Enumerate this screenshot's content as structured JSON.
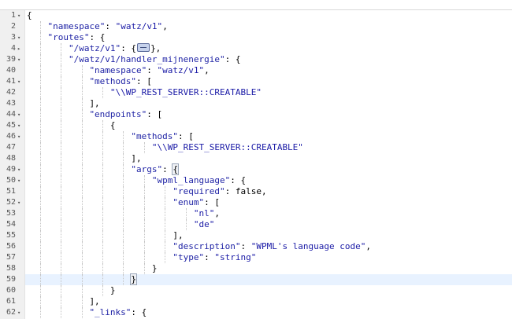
{
  "lines": [
    {
      "num": "1",
      "fold": "open",
      "indent": 0,
      "tokens": [
        [
          "plain",
          "{"
        ]
      ]
    },
    {
      "num": "2",
      "indent": 1,
      "tokens": [
        [
          "key",
          "\"namespace\""
        ],
        [
          "plain",
          ": "
        ],
        [
          "str",
          "\"watz/v1\""
        ],
        [
          "plain",
          ","
        ]
      ]
    },
    {
      "num": "3",
      "fold": "open",
      "indent": 1,
      "tokens": [
        [
          "key",
          "\"routes\""
        ],
        [
          "plain",
          ": {"
        ]
      ]
    },
    {
      "num": "4",
      "fold": "closed",
      "indent": 2,
      "tokens": [
        [
          "key",
          "\"/watz/v1\""
        ],
        [
          "plain",
          ": {"
        ],
        [
          "widget",
          ""
        ],
        [
          "plain",
          "},"
        ]
      ]
    },
    {
      "num": "39",
      "fold": "open",
      "indent": 2,
      "tokens": [
        [
          "key",
          "\"/watz/v1/handler_mijnenergie\""
        ],
        [
          "plain",
          ": {"
        ]
      ]
    },
    {
      "num": "40",
      "indent": 3,
      "tokens": [
        [
          "key",
          "\"namespace\""
        ],
        [
          "plain",
          ": "
        ],
        [
          "str",
          "\"watz/v1\""
        ],
        [
          "plain",
          ","
        ]
      ]
    },
    {
      "num": "41",
      "fold": "open",
      "indent": 3,
      "tokens": [
        [
          "key",
          "\"methods\""
        ],
        [
          "plain",
          ": ["
        ]
      ]
    },
    {
      "num": "42",
      "indent": 4,
      "tokens": [
        [
          "str",
          "\"\\\\WP_REST_SERVER::CREATABLE\""
        ]
      ]
    },
    {
      "num": "43",
      "indent": 3,
      "tokens": [
        [
          "plain",
          "],"
        ]
      ]
    },
    {
      "num": "44",
      "fold": "open",
      "indent": 3,
      "tokens": [
        [
          "key",
          "\"endpoints\""
        ],
        [
          "plain",
          ": ["
        ]
      ]
    },
    {
      "num": "45",
      "fold": "open",
      "indent": 4,
      "tokens": [
        [
          "plain",
          "{"
        ]
      ]
    },
    {
      "num": "46",
      "fold": "open",
      "indent": 5,
      "tokens": [
        [
          "key",
          "\"methods\""
        ],
        [
          "plain",
          ": ["
        ]
      ]
    },
    {
      "num": "47",
      "indent": 6,
      "tokens": [
        [
          "str",
          "\"\\\\WP_REST_SERVER::CREATABLE\""
        ]
      ]
    },
    {
      "num": "48",
      "indent": 5,
      "tokens": [
        [
          "plain",
          "],"
        ]
      ]
    },
    {
      "num": "49",
      "fold": "open",
      "indent": 5,
      "tokens": [
        [
          "key",
          "\"args\""
        ],
        [
          "plain",
          ": "
        ],
        [
          "bracket",
          "{"
        ]
      ]
    },
    {
      "num": "50",
      "fold": "open",
      "indent": 6,
      "tokens": [
        [
          "key",
          "\"wpml_language\""
        ],
        [
          "plain",
          ": {"
        ]
      ]
    },
    {
      "num": "51",
      "indent": 7,
      "tokens": [
        [
          "key",
          "\"required\""
        ],
        [
          "plain",
          ": "
        ],
        [
          "lit",
          "false"
        ],
        [
          "plain",
          ","
        ]
      ]
    },
    {
      "num": "52",
      "fold": "open",
      "indent": 7,
      "tokens": [
        [
          "key",
          "\"enum\""
        ],
        [
          "plain",
          ": ["
        ]
      ]
    },
    {
      "num": "53",
      "indent": 8,
      "tokens": [
        [
          "str",
          "\"nl\""
        ],
        [
          "plain",
          ","
        ]
      ]
    },
    {
      "num": "54",
      "indent": 8,
      "tokens": [
        [
          "str",
          "\"de\""
        ]
      ]
    },
    {
      "num": "55",
      "indent": 7,
      "tokens": [
        [
          "plain",
          "],"
        ]
      ]
    },
    {
      "num": "56",
      "indent": 7,
      "tokens": [
        [
          "key",
          "\"description\""
        ],
        [
          "plain",
          ": "
        ],
        [
          "str",
          "\"WPML's language code\""
        ],
        [
          "plain",
          ","
        ]
      ]
    },
    {
      "num": "57",
      "indent": 7,
      "tokens": [
        [
          "key",
          "\"type\""
        ],
        [
          "plain",
          ": "
        ],
        [
          "str",
          "\"string\""
        ]
      ]
    },
    {
      "num": "58",
      "indent": 6,
      "tokens": [
        [
          "plain",
          "}"
        ]
      ]
    },
    {
      "num": "59",
      "indent": 5,
      "active": true,
      "tokens": [
        [
          "bracket",
          "}"
        ],
        [
          "cursor",
          ""
        ]
      ]
    },
    {
      "num": "60",
      "indent": 4,
      "tokens": [
        [
          "plain",
          "}"
        ]
      ]
    },
    {
      "num": "61",
      "indent": 3,
      "tokens": [
        [
          "plain",
          "],"
        ]
      ]
    },
    {
      "num": "62",
      "fold": "open",
      "indent": 3,
      "tokens": [
        [
          "key",
          "\"_links\""
        ],
        [
          "plain",
          ": {"
        ]
      ]
    }
  ],
  "icons": {
    "fold_open": "▾",
    "fold_closed": "▸"
  },
  "colors": {
    "key": "#1f23a5",
    "string": "#1a1aa6",
    "gutter_bg": "#f0f0f0",
    "active_line_bg": "#e8f2ff"
  }
}
